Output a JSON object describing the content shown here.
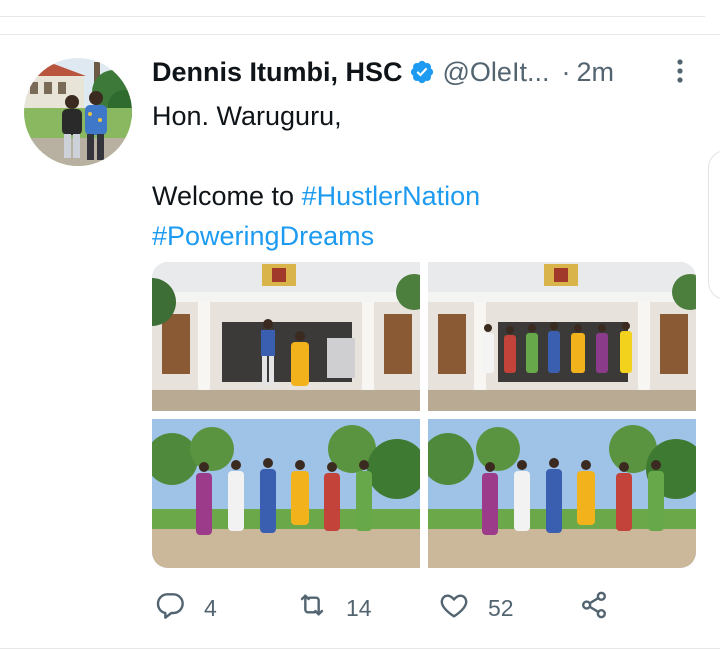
{
  "tweet": {
    "author_name": "Dennis Itumbi, HSC",
    "handle": "@OleIt...",
    "separator": "·",
    "timestamp": "2m",
    "verified": true,
    "text_lines": [
      {
        "parts": [
          {
            "text": "Hon. Waruguru,",
            "hashtag": false
          }
        ]
      },
      {
        "parts": []
      },
      {
        "parts": [
          {
            "text": "Welcome to ",
            "hashtag": false
          },
          {
            "text": "#HustlerNation",
            "hashtag": true
          }
        ]
      },
      {
        "parts": [
          {
            "text": "#PoweringDreams",
            "hashtag": true
          }
        ]
      }
    ],
    "photos": [
      {
        "scene": "building-entrance",
        "people": 2
      },
      {
        "scene": "building-entrance",
        "people": 8
      },
      {
        "scene": "garden-walk",
        "people": 6
      },
      {
        "scene": "garden-walk",
        "people": 6
      }
    ],
    "actions": {
      "reply_count": "4",
      "retweet_count": "14",
      "like_count": "52"
    }
  },
  "icons": {
    "verified": "verified-badge-icon",
    "more": "more-vertical-icon",
    "reply": "reply-icon",
    "retweet": "retweet-icon",
    "like": "heart-icon",
    "share": "share-icon"
  },
  "colors": {
    "text": "#0f1419",
    "secondary": "#536471",
    "link": "#1d9bf0",
    "divider": "#e6e9eb"
  }
}
